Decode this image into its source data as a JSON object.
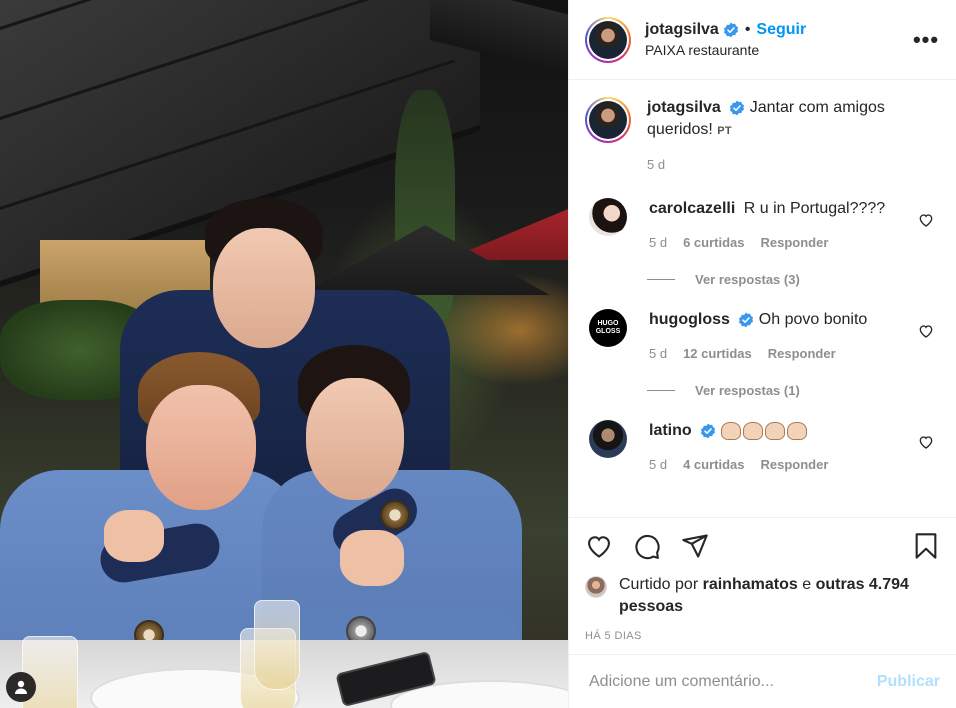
{
  "post": {
    "author": {
      "username": "jotagsilva",
      "verified": true,
      "location": "PAIXA restaurante"
    },
    "header": {
      "separator": "•",
      "follow_label": "Seguir",
      "more_icon": "more-horizontal-icon",
      "more_label": "•••"
    },
    "caption": {
      "username": "jotagsilva",
      "text": "Jantar com amigos queridos!",
      "translate_badge": "PT",
      "age": "5 d"
    },
    "comments": [
      {
        "username": "carolcazelli",
        "verified": false,
        "text": "R u in Portugal????",
        "age": "5 d",
        "likes": "6 curtidas",
        "reply_label": "Responder",
        "view_replies": "Ver respostas (3)"
      },
      {
        "username": "hugogloss",
        "verified": true,
        "avatar_text": [
          "HUGO",
          "GLOSS"
        ],
        "text": "Oh povo bonito",
        "age": "5 d",
        "likes": "12 curtidas",
        "reply_label": "Responder",
        "view_replies": "Ver respostas (1)"
      },
      {
        "username": "latino",
        "verified": true,
        "text": "",
        "text_emoji": "clapping-hands x4",
        "age": "5 d",
        "likes": "4 curtidas",
        "reply_label": "Responder"
      }
    ],
    "actions": {
      "like_icon": "heart-icon",
      "comment_icon": "comment-icon",
      "share_icon": "paper-plane-icon",
      "save_icon": "bookmark-icon"
    },
    "likes": {
      "prefix": "Curtido por",
      "user": "rainhamatos",
      "connector": "e",
      "others": "outras 4.794 pessoas"
    },
    "date": "HÁ 5 DIAS",
    "add_comment": {
      "placeholder": "Adicione um comentário...",
      "publish_label": "Publicar"
    }
  },
  "colors": {
    "accent": "#0095f6",
    "publish_disabled": "#b2dffc",
    "muted": "#8e8e8e",
    "text": "#262626",
    "verified": "#3897f0"
  }
}
